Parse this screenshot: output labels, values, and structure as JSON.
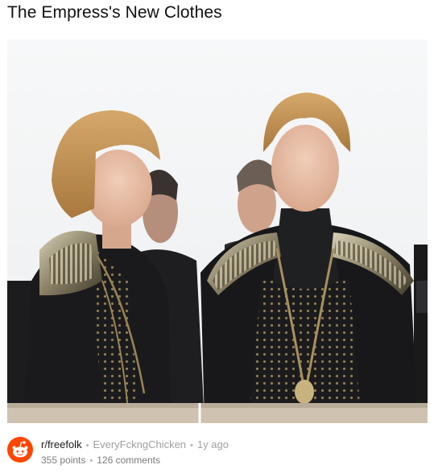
{
  "post": {
    "title": "The Empress's New Clothes",
    "image_icon": "photo-of-two-women-in-costume",
    "subreddit": "r/freefolk",
    "author": "EveryFckngChicken",
    "age": "1y ago",
    "points": "355 points",
    "comments": "126 comments",
    "separator": "•"
  },
  "colors": {
    "brand": "#ff4500",
    "muted_text": "#a0a0a0",
    "background": "#ffffff"
  },
  "icons": {
    "avatar": "reddit-snoo-icon"
  }
}
